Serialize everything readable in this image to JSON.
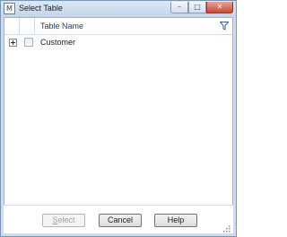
{
  "window": {
    "title": "Select Table",
    "app_icon_glyph": "M",
    "controls": {
      "minimize_glyph": "–",
      "maximize_glyph": "□",
      "close_glyph": "✕"
    }
  },
  "grid": {
    "column_header": "Table Name",
    "filter_icon": "funnel-icon",
    "rows": [
      {
        "label": "Customer",
        "expanded": false,
        "checked": false
      }
    ]
  },
  "buttons": {
    "select_mnemonic": "S",
    "select_rest": "elect",
    "select_enabled": false,
    "cancel": "Cancel",
    "help": "Help"
  },
  "colors": {
    "titlebar": "#cfdcec",
    "close_button": "#c54a35",
    "header_text": "#1e395b"
  }
}
